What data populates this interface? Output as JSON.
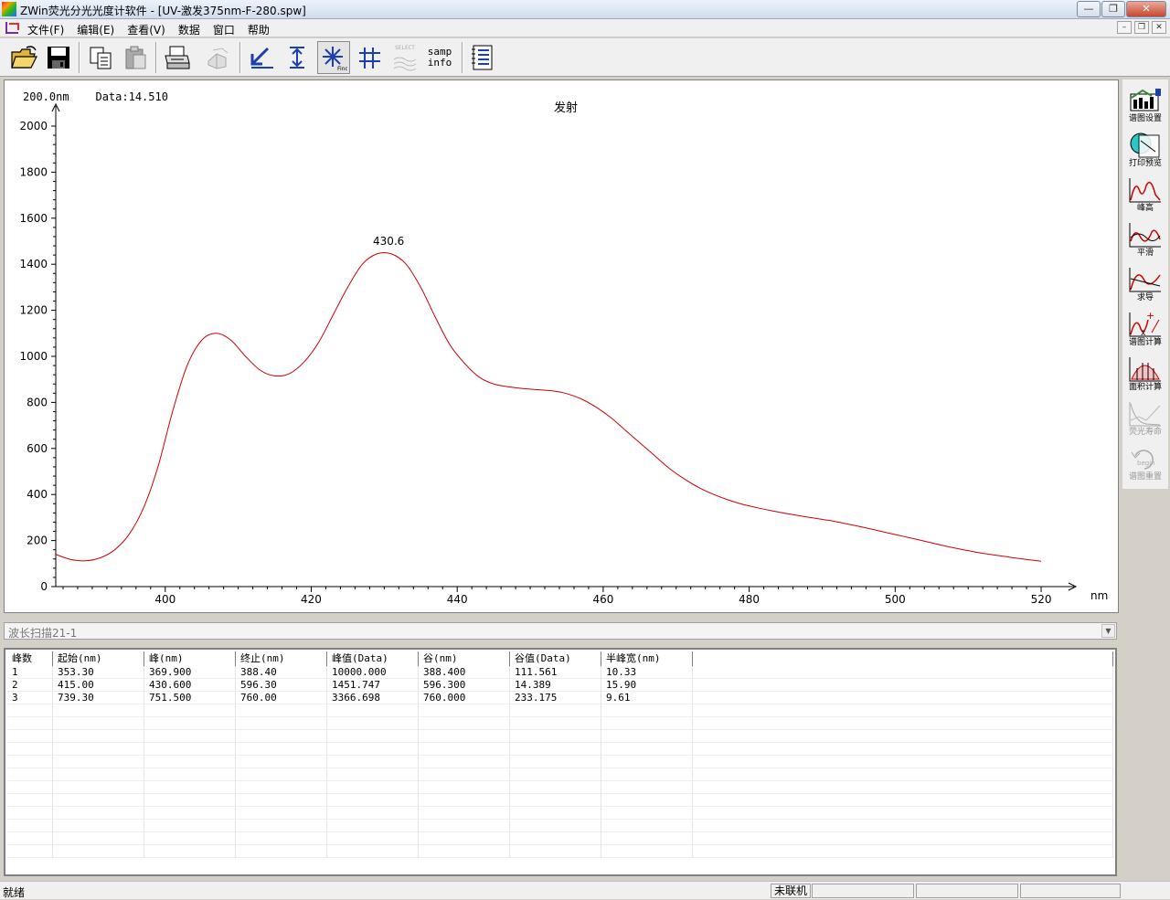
{
  "window": {
    "title": "ZWin荧光分光光度计软件 - [UV-激发375nm-F-280.spw]"
  },
  "menu": {
    "items": [
      "文件(F)",
      "编辑(E)",
      "查看(V)",
      "数据",
      "窗口",
      "帮助"
    ]
  },
  "toolbar": {
    "samp_info_line1": "samp",
    "samp_info_line2": "info",
    "select_label": "SELECT"
  },
  "readout": {
    "wavelength": "200.0nm",
    "data": "Data:14.510"
  },
  "chart_data": {
    "type": "line",
    "title": "发射",
    "xlabel": "nm",
    "ylabel": "",
    "xlim": [
      385,
      522
    ],
    "ylim": [
      0,
      2000
    ],
    "x_ticks": [
      400,
      420,
      440,
      460,
      480,
      500,
      520
    ],
    "y_ticks": [
      0,
      200,
      400,
      600,
      800,
      1000,
      1200,
      1400,
      1600,
      1800,
      2000
    ],
    "peak_annotation": {
      "label": "430.6",
      "x": 430.6,
      "y": 1452
    },
    "grid": false,
    "series": [
      {
        "color": "#cc0000",
        "x": [
          385,
          387,
          389,
          391,
          393,
          395,
          397,
          399,
          401,
          403,
          405,
          407,
          409,
          411,
          413,
          415,
          417,
          419,
          421,
          423,
          425,
          427,
          429,
          431,
          433,
          435,
          437,
          439,
          441,
          443,
          445,
          447,
          449,
          451,
          453,
          455,
          457,
          459,
          461,
          463,
          465,
          467,
          469,
          471,
          473,
          475,
          477,
          479,
          481,
          483,
          485,
          487,
          489,
          491,
          493,
          495,
          497,
          499,
          501,
          503,
          505,
          507,
          509,
          511,
          513,
          515,
          517,
          520
        ],
        "y": [
          140,
          118,
          112,
          124,
          158,
          225,
          340,
          520,
          760,
          960,
          1070,
          1100,
          1070,
          1000,
          940,
          915,
          925,
          975,
          1060,
          1180,
          1300,
          1400,
          1445,
          1445,
          1400,
          1300,
          1170,
          1050,
          970,
          910,
          880,
          868,
          860,
          855,
          850,
          838,
          815,
          780,
          735,
          680,
          625,
          570,
          515,
          470,
          432,
          402,
          378,
          358,
          343,
          330,
          318,
          307,
          297,
          287,
          275,
          262,
          248,
          233,
          219,
          205,
          190,
          175,
          162,
          150,
          140,
          131,
          122,
          110
        ]
      }
    ]
  },
  "right_toolbar": {
    "buttons": [
      {
        "label": "谱图设置",
        "disabled": false
      },
      {
        "label": "打印预览",
        "disabled": false
      },
      {
        "label": "峰高",
        "disabled": false
      },
      {
        "label": "平滑",
        "disabled": false
      },
      {
        "label": "求导",
        "disabled": false
      },
      {
        "label": "谱图计算",
        "disabled": false
      },
      {
        "label": "面积计算",
        "disabled": false
      },
      {
        "label": "荧光寿命",
        "disabled": true
      },
      {
        "label": "谱图重置",
        "disabled": true
      }
    ]
  },
  "scan_select": {
    "value": "波长扫描21-1"
  },
  "peak_table": {
    "headers": [
      "峰数",
      "起始(nm)",
      "峰(nm)",
      "终止(nm)",
      "峰值(Data)",
      "谷(nm)",
      "谷值(Data)",
      "半峰宽(nm)"
    ],
    "rows": [
      [
        "1",
        "353.30",
        "369.900",
        "388.40",
        "10000.000",
        "388.400",
        "111.561",
        "10.33"
      ],
      [
        "2",
        "415.00",
        "430.600",
        "596.30",
        "1451.747",
        "596.300",
        "14.389",
        "15.90"
      ],
      [
        "3",
        "739.30",
        "751.500",
        "760.00",
        "3366.698",
        "760.000",
        "233.175",
        "9.61"
      ]
    ]
  },
  "statusbar": {
    "status": "就绪",
    "connection": "未联机"
  }
}
